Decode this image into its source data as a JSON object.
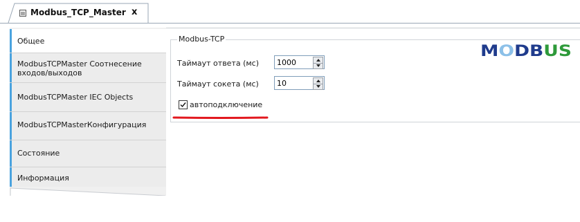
{
  "tab": {
    "title": "Modbus_TCP_Master",
    "close": "x"
  },
  "nav": {
    "items": [
      {
        "label": "Общее"
      },
      {
        "label_line1": "ModbusTCPMaster Соотнесение",
        "label_line2": "входов/выходов"
      },
      {
        "label": "ModbusTCPMaster IEC Objects"
      },
      {
        "label": "ModbusTCPMasterКонфигурация"
      },
      {
        "label": "Состояние"
      },
      {
        "label": "Информация"
      }
    ]
  },
  "group": {
    "title": "Modbus-TCP",
    "response_timeout": {
      "label": "Таймаут ответа (мс)",
      "value": "1000"
    },
    "socket_timeout": {
      "label": "Таймаут сокета (мс)",
      "value": "10"
    },
    "autoconnect": {
      "label": "автоподключение",
      "checked": true
    }
  },
  "logo": {
    "text": "MODBUS",
    "colors": {
      "dark": "#1f3b8c",
      "light": "#8cc0e8",
      "green": "#2e9a3a"
    }
  },
  "colors": {
    "accent": "#4aa3df",
    "underline": "#e2171d"
  }
}
